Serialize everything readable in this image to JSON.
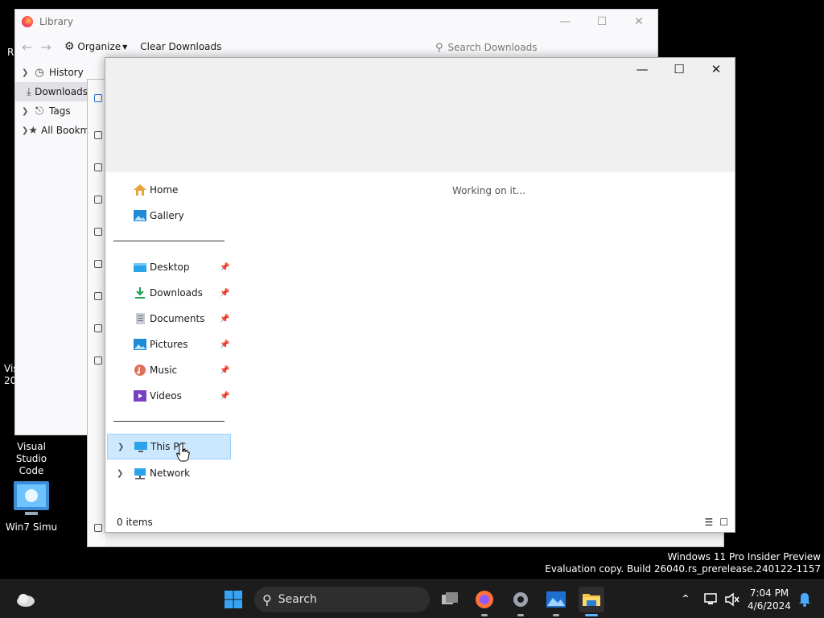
{
  "desktop": {
    "icons": [
      {
        "label": "Visual Studio Code"
      },
      {
        "label": "Win7 Simu"
      }
    ],
    "partial_labels": {
      "r": "R",
      "vis": "Vis",
      "year": "20"
    }
  },
  "library": {
    "title": "Library",
    "toolbar": {
      "organize": "Organize",
      "clear": "Clear Downloads"
    },
    "search_placeholder": "Search Downloads",
    "tree": [
      {
        "label": "History"
      },
      {
        "label": "Downloads"
      },
      {
        "label": "Tags"
      },
      {
        "label": "All Bookmarks"
      }
    ]
  },
  "explorer": {
    "nav": {
      "home": "Home",
      "gallery": "Gallery",
      "desktop": "Desktop",
      "downloads": "Downloads",
      "documents": "Documents",
      "pictures": "Pictures",
      "music": "Music",
      "videos": "Videos",
      "this_pc": "This PC",
      "network": "Network"
    },
    "working": "Working on it...",
    "status": "0 items"
  },
  "watermark": {
    "line1": "Windows 11 Pro Insider Preview",
    "line2": "Evaluation copy. Build 26040.rs_prerelease.240122-1157"
  },
  "taskbar": {
    "search": "Search",
    "time": "7:04 PM",
    "date": "4/6/2024"
  }
}
